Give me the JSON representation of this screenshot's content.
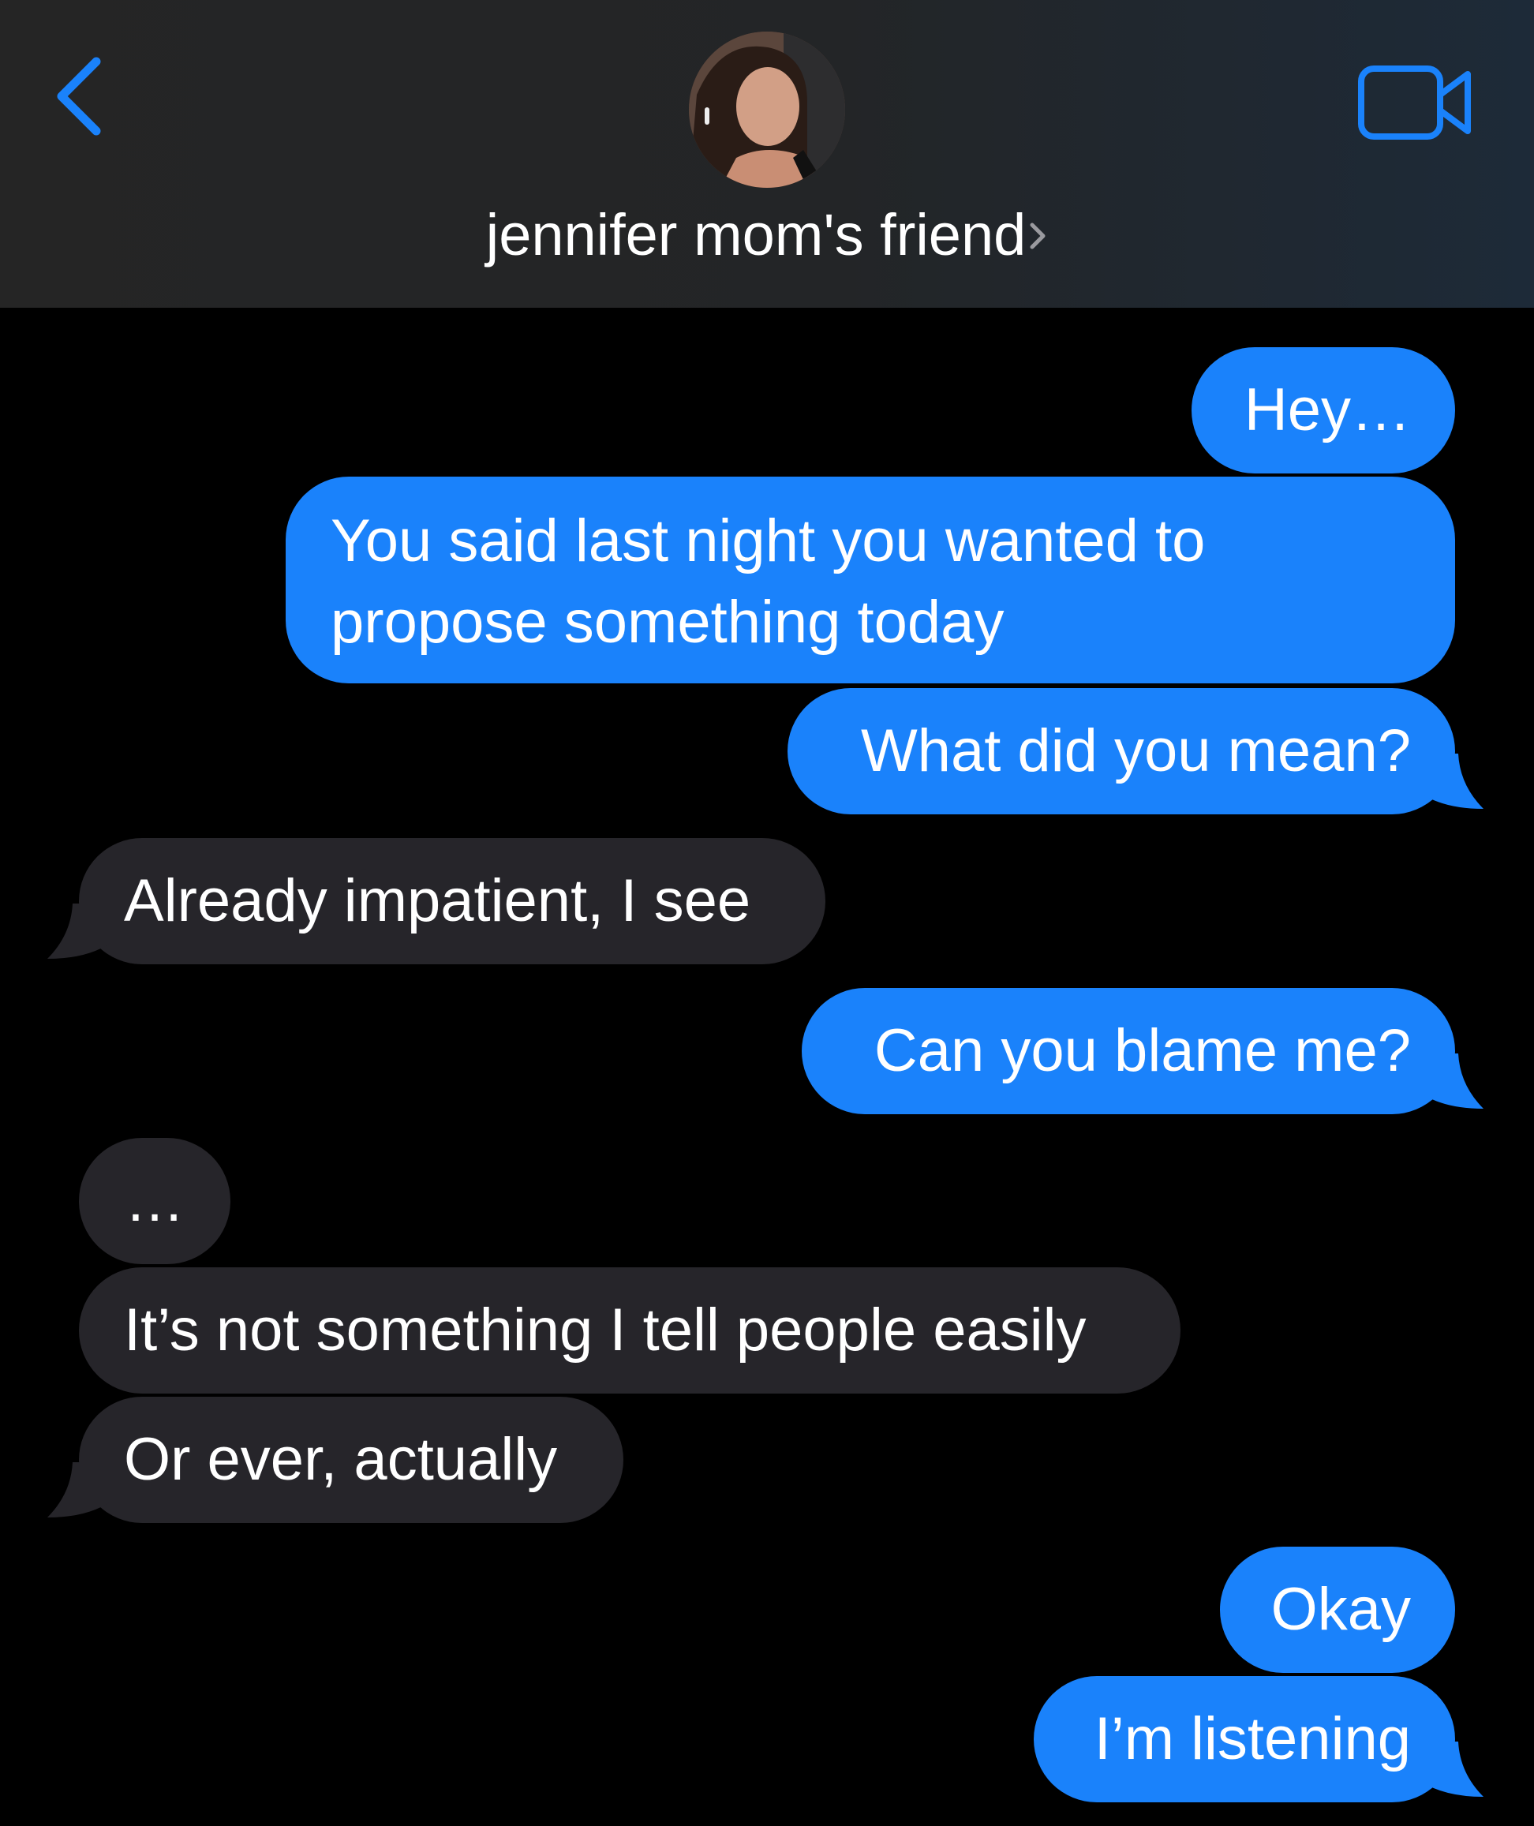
{
  "header": {
    "contact_name": "jennifer mom's friend",
    "back_icon": "chevron-left-icon",
    "video_icon": "video-camera-icon",
    "name_chevron_icon": "chevron-right-icon",
    "accent_color": "#1a82fb"
  },
  "messages": [
    {
      "sender": "me",
      "text": "Hey…"
    },
    {
      "sender": "me",
      "text_lines": [
        "You said last night you wanted to",
        "propose something today"
      ]
    },
    {
      "sender": "me",
      "text": "What did you mean?"
    },
    {
      "sender": "contact",
      "text": "Already impatient, I see"
    },
    {
      "sender": "me",
      "text": "Can you blame me?"
    },
    {
      "sender": "contact",
      "text": "…"
    },
    {
      "sender": "contact",
      "text": "It’s not something I tell people easily"
    },
    {
      "sender": "contact",
      "text": "Or ever, actually"
    },
    {
      "sender": "me",
      "text": "Okay"
    },
    {
      "sender": "me",
      "text": "I’m listening"
    }
  ],
  "colors": {
    "outgoing_bubble": "#1a82fb",
    "incoming_bubble": "#26252a",
    "background": "#000000"
  }
}
